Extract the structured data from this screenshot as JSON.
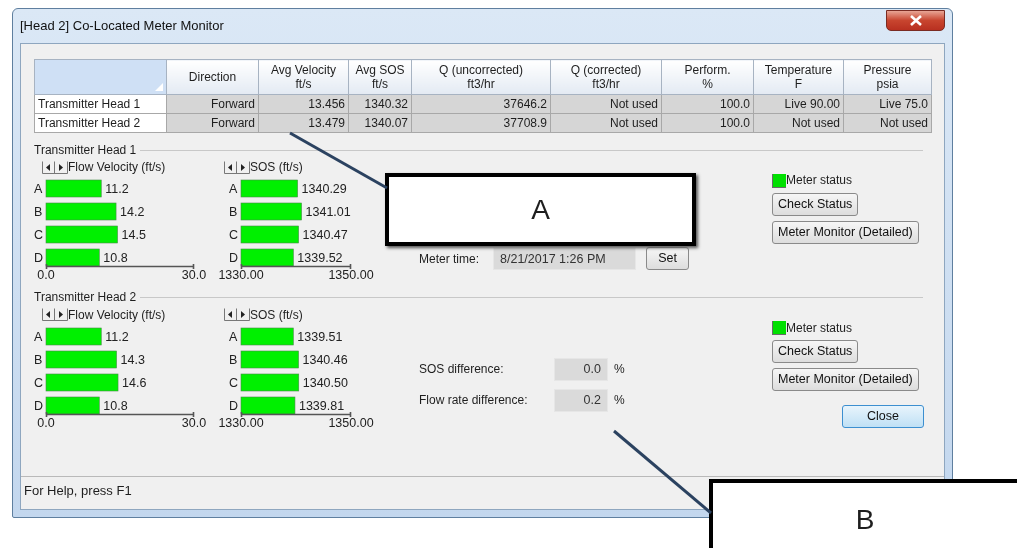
{
  "window": {
    "title": "[Head 2] Co-Located Meter Monitor"
  },
  "table": {
    "columns": [
      {
        "title": "Direction"
      },
      {
        "title": "Avg Velocity",
        "unit": "ft/s"
      },
      {
        "title": "Avg SOS",
        "unit": "ft/s"
      },
      {
        "title": "Q (uncorrected)",
        "unit": "ft3/hr"
      },
      {
        "title": "Q (corrected)",
        "unit": "ft3/hr"
      },
      {
        "title": "Perform.",
        "unit": "%"
      },
      {
        "title": "Temperature",
        "unit": "F"
      },
      {
        "title": "Pressure",
        "unit": "psia"
      }
    ],
    "rows": [
      {
        "head": "Transmitter Head 1",
        "cells": [
          "Forward",
          "13.456",
          "1340.32",
          "37646.2",
          "Not used",
          "100.0",
          "Live 90.00",
          "Live 75.0"
        ]
      },
      {
        "head": "Transmitter Head 2",
        "cells": [
          "Forward",
          "13.479",
          "1340.07",
          "37708.9",
          "Not used",
          "100.0",
          "Not used",
          "Not used"
        ]
      }
    ]
  },
  "heads": [
    {
      "title": "Transmitter Head 1",
      "charts": [
        {
          "chart_data": {
            "type": "bar",
            "orientation": "horizontal",
            "title": "Flow Velocity (ft/s)",
            "categories": [
              "A",
              "B",
              "C",
              "D"
            ],
            "values": [
              11.2,
              14.2,
              14.5,
              10.8
            ],
            "value_labels": [
              "11.2",
              "14.2",
              "14.5",
              "10.8"
            ],
            "xlim": [
              0,
              30
            ],
            "xticks": [
              {
                "value": 0,
                "label": "0.0"
              },
              {
                "value": 30,
                "label": "30.0"
              }
            ]
          }
        },
        {
          "chart_data": {
            "type": "bar",
            "orientation": "horizontal",
            "title": "SOS (ft/s)",
            "categories": [
              "A",
              "B",
              "C",
              "D"
            ],
            "values": [
              1340.29,
              1341.01,
              1340.47,
              1339.52
            ],
            "value_labels": [
              "1340.29",
              "1341.01",
              "1340.47",
              "1339.52"
            ],
            "xlim": [
              1330,
              1350
            ],
            "xticks": [
              {
                "value": 1330,
                "label": "1330.00"
              },
              {
                "value": 1350,
                "label": "1350.00"
              }
            ]
          }
        }
      ],
      "meter_time": {
        "label": "Meter time:",
        "value": "8/21/2017 1:26 PM",
        "button": "Set"
      },
      "meter_status": {
        "label": "Meter status",
        "color": "#00e000"
      },
      "buttons": [
        "Check Status",
        "Meter Monitor (Detailed)"
      ]
    },
    {
      "title": "Transmitter Head 2",
      "charts": [
        {
          "chart_data": {
            "type": "bar",
            "orientation": "horizontal",
            "title": "Flow Velocity (ft/s)",
            "categories": [
              "A",
              "B",
              "C",
              "D"
            ],
            "values": [
              11.2,
              14.3,
              14.6,
              10.8
            ],
            "value_labels": [
              "11.2",
              "14.3",
              "14.6",
              "10.8"
            ],
            "xlim": [
              0,
              30
            ],
            "xticks": [
              {
                "value": 0,
                "label": "0.0"
              },
              {
                "value": 30,
                "label": "30.0"
              }
            ]
          }
        },
        {
          "chart_data": {
            "type": "bar",
            "orientation": "horizontal",
            "title": "SOS (ft/s)",
            "categories": [
              "A",
              "B",
              "C",
              "D"
            ],
            "values": [
              1339.51,
              1340.46,
              1340.5,
              1339.81
            ],
            "value_labels": [
              "1339.51",
              "1340.46",
              "1340.50",
              "1339.81"
            ],
            "xlim": [
              1330,
              1350
            ],
            "xticks": [
              {
                "value": 1330,
                "label": "1330.00"
              },
              {
                "value": 1350,
                "label": "1350.00"
              }
            ]
          }
        }
      ],
      "differences": [
        {
          "label": "SOS difference:",
          "value": "0.0",
          "unit": "%"
        },
        {
          "label": "Flow rate difference:",
          "value": "0.2",
          "unit": "%"
        }
      ],
      "meter_status": {
        "label": "Meter status",
        "color": "#00e000"
      },
      "buttons": [
        "Check Status",
        "Meter Monitor (Detailed)"
      ]
    }
  ],
  "close_button": "Close",
  "status_bar": "For Help, press F1",
  "callouts": [
    {
      "label": "A"
    },
    {
      "label": "B"
    }
  ]
}
